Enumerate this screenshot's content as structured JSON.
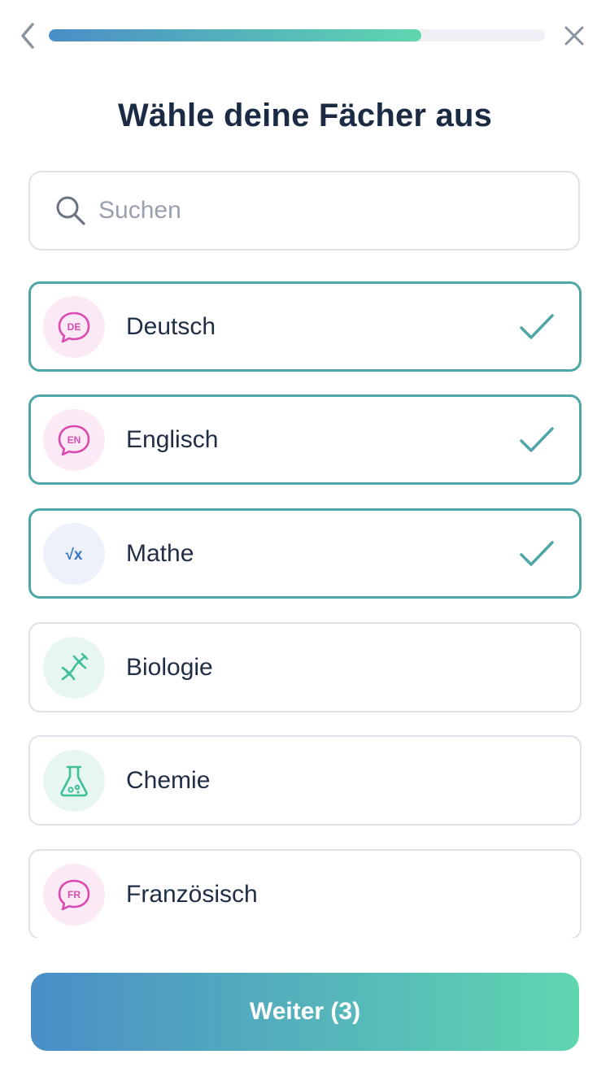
{
  "progress": 0.75,
  "header": {
    "back_icon": "chevron-left-icon",
    "close_icon": "close-icon"
  },
  "title": "Wähle deine Fächer aus",
  "search": {
    "placeholder": "Suchen",
    "value": "",
    "icon": "search-icon"
  },
  "subjects": [
    {
      "label": "Deutsch",
      "icon": "speech-bubble-de-icon",
      "icon_text": "DE",
      "selected": true,
      "icon_color": "#d94bb0",
      "icon_bg": "#fbeaf5"
    },
    {
      "label": "Englisch",
      "icon": "speech-bubble-en-icon",
      "icon_text": "EN",
      "selected": true,
      "icon_color": "#d94bb0",
      "icon_bg": "#fbeaf5"
    },
    {
      "label": "Mathe",
      "icon": "square-root-icon",
      "icon_text": "√x",
      "selected": true,
      "icon_color": "#3a78c9",
      "icon_bg": "#ecf1fa"
    },
    {
      "label": "Biologie",
      "icon": "dna-icon",
      "selected": false,
      "icon_color": "#3fbf9a",
      "icon_bg": "#e8f6f2"
    },
    {
      "label": "Chemie",
      "icon": "flask-icon",
      "selected": false,
      "icon_color": "#3fbf9a",
      "icon_bg": "#e8f6f2"
    },
    {
      "label": "Französisch",
      "icon": "speech-bubble-fr-icon",
      "icon_text": "FR",
      "selected": false,
      "icon_color": "#d94bb0",
      "icon_bg": "#fbeaf5"
    }
  ],
  "cta": {
    "label": "Weiter (3)"
  },
  "colors": {
    "accent_start": "#4a8ec7",
    "accent_end": "#5fd6b0",
    "selected_border": "#4ea6a6",
    "check": "#4ea6a6",
    "text": "#1f2d45"
  }
}
